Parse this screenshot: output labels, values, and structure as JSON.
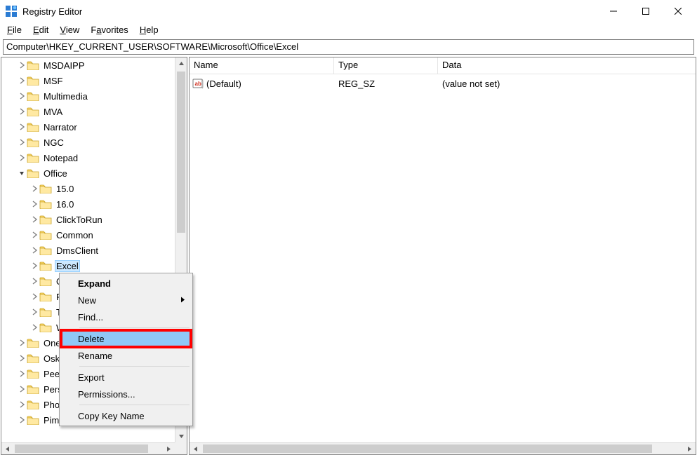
{
  "title": "Registry Editor",
  "window_controls": {
    "min": "minimize",
    "max": "maximize",
    "close": "close"
  },
  "menubar": {
    "file": {
      "label": "File",
      "mnemonic_index": 0
    },
    "edit": {
      "label": "Edit",
      "mnemonic_index": 0
    },
    "view": {
      "label": "View",
      "mnemonic_index": 0
    },
    "favorites": {
      "label": "Favorites",
      "mnemonic_index": 0
    },
    "help": {
      "label": "Help",
      "mnemonic_index": 0
    }
  },
  "address_path": "Computer\\HKEY_CURRENT_USER\\SOFTWARE\\Microsoft\\Office\\Excel",
  "tree": [
    {
      "depth": 1,
      "expandable": true,
      "expanded": false,
      "label": "MSDAIPP",
      "selected": false
    },
    {
      "depth": 1,
      "expandable": true,
      "expanded": false,
      "label": "MSF",
      "selected": false
    },
    {
      "depth": 1,
      "expandable": true,
      "expanded": false,
      "label": "Multimedia",
      "selected": false
    },
    {
      "depth": 1,
      "expandable": true,
      "expanded": false,
      "label": "MVA",
      "selected": false
    },
    {
      "depth": 1,
      "expandable": true,
      "expanded": false,
      "label": "Narrator",
      "selected": false
    },
    {
      "depth": 1,
      "expandable": true,
      "expanded": false,
      "label": "NGC",
      "selected": false
    },
    {
      "depth": 1,
      "expandable": true,
      "expanded": false,
      "label": "Notepad",
      "selected": false
    },
    {
      "depth": 1,
      "expandable": true,
      "expanded": true,
      "label": "Office",
      "selected": false
    },
    {
      "depth": 2,
      "expandable": true,
      "expanded": false,
      "label": "15.0",
      "selected": false
    },
    {
      "depth": 2,
      "expandable": true,
      "expanded": false,
      "label": "16.0",
      "selected": false
    },
    {
      "depth": 2,
      "expandable": true,
      "expanded": false,
      "label": "ClickToRun",
      "selected": false
    },
    {
      "depth": 2,
      "expandable": true,
      "expanded": false,
      "label": "Common",
      "selected": false
    },
    {
      "depth": 2,
      "expandable": true,
      "expanded": false,
      "label": "DmsClient",
      "selected": false
    },
    {
      "depth": 2,
      "expandable": true,
      "expanded": false,
      "label": "Excel",
      "selected": true
    },
    {
      "depth": 2,
      "expandable": true,
      "expanded": false,
      "label": "O",
      "selected": false,
      "truncated": true
    },
    {
      "depth": 2,
      "expandable": true,
      "expanded": false,
      "label": "P",
      "selected": false,
      "truncated": true
    },
    {
      "depth": 2,
      "expandable": true,
      "expanded": false,
      "label": "T",
      "selected": false,
      "truncated": true
    },
    {
      "depth": 2,
      "expandable": true,
      "expanded": false,
      "label": "W",
      "selected": false,
      "truncated": true
    },
    {
      "depth": 1,
      "expandable": true,
      "expanded": false,
      "label": "One",
      "selected": false,
      "truncated": true
    },
    {
      "depth": 1,
      "expandable": true,
      "expanded": false,
      "label": "Osk",
      "selected": false,
      "truncated": true
    },
    {
      "depth": 1,
      "expandable": true,
      "expanded": false,
      "label": "Peer",
      "selected": false,
      "truncated": true
    },
    {
      "depth": 1,
      "expandable": true,
      "expanded": false,
      "label": "Pers",
      "selected": false,
      "truncated": true
    },
    {
      "depth": 1,
      "expandable": true,
      "expanded": false,
      "label": "Phon",
      "selected": false,
      "truncated": true
    },
    {
      "depth": 1,
      "expandable": true,
      "expanded": false,
      "label": "Pim",
      "selected": false,
      "truncated": true
    }
  ],
  "list": {
    "columns": {
      "name": "Name",
      "type": "Type",
      "data": "Data"
    },
    "rows": [
      {
        "icon": "string-value-icon",
        "name": "(Default)",
        "type": "REG_SZ",
        "data": "(value not set)"
      }
    ]
  },
  "context_menu": {
    "items": [
      {
        "label": "Expand",
        "bold": true,
        "submenu": false,
        "highlighted": false
      },
      {
        "label": "New",
        "bold": false,
        "submenu": true,
        "highlighted": false
      },
      {
        "label": "Find...",
        "bold": false,
        "submenu": false,
        "highlighted": false
      },
      {
        "separator": true
      },
      {
        "label": "Delete",
        "bold": false,
        "submenu": false,
        "highlighted": true,
        "selected": true
      },
      {
        "label": "Rename",
        "bold": false,
        "submenu": false,
        "highlighted": false
      },
      {
        "separator": true
      },
      {
        "label": "Export",
        "bold": false,
        "submenu": false,
        "highlighted": false
      },
      {
        "label": "Permissions...",
        "bold": false,
        "submenu": false,
        "highlighted": false
      },
      {
        "separator": true
      },
      {
        "label": "Copy Key Name",
        "bold": false,
        "submenu": false,
        "highlighted": false
      }
    ]
  }
}
